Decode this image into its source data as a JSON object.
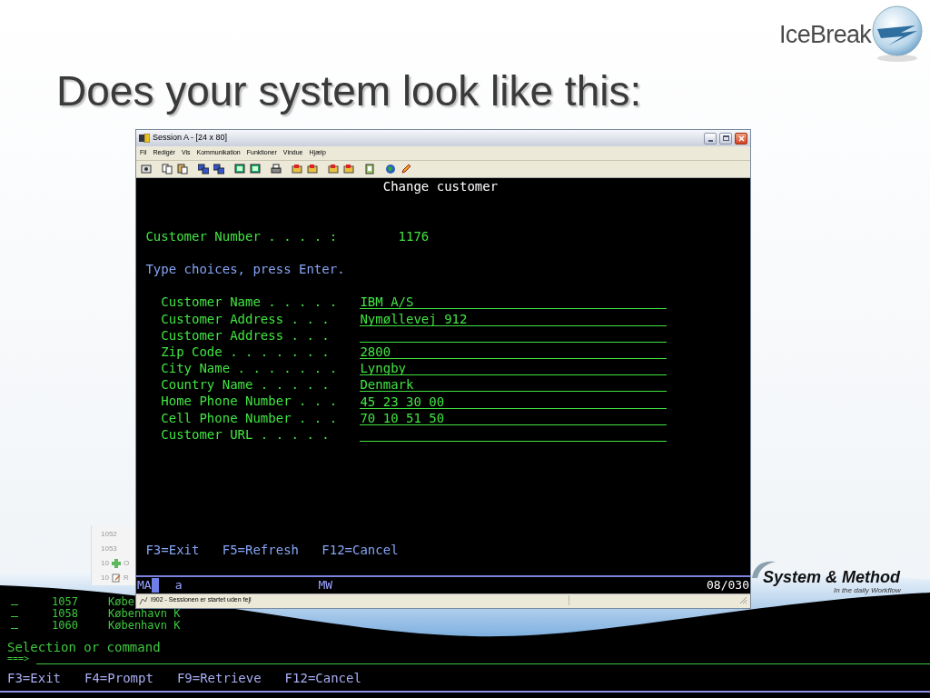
{
  "slide": {
    "title": "Does your system look like this:"
  },
  "logos": {
    "top_name": "IceBreak",
    "bottom_name": "System & Method",
    "bottom_tagline": "In the daily Workflow"
  },
  "background_list": [
    {
      "number": "1052"
    },
    {
      "number": "1053"
    },
    {
      "number": "10",
      "label": "O",
      "kind": "plus"
    },
    {
      "number": "10",
      "label": "R",
      "kind": "note"
    }
  ],
  "window": {
    "title": "Session A - [24 x 80]",
    "menu": [
      "Fil",
      "Redigér",
      "Vis",
      "Kommunikation",
      "Funktioner",
      "Vindue",
      "Hjælp"
    ],
    "screen": {
      "heading": "Change customer",
      "number_label": "Customer Number . . . . :",
      "number_value": "1176",
      "instruction": "Type choices, press Enter.",
      "fields": [
        {
          "label": "Customer Name . . . . .",
          "value": "IBM A/S"
        },
        {
          "label": "Customer Address . . .",
          "value": "Nymøllevej 912"
        },
        {
          "label": "Customer Address . . ."
        },
        {
          "label": "Zip Code . . . . . . .",
          "value": "2800"
        },
        {
          "label": "City Name . . . . . . .",
          "value": "Lyngby"
        },
        {
          "label": "Country Name . . . . .",
          "value": "Denmark"
        },
        {
          "label": "Home Phone Number . . .",
          "value": "45 23 30 00"
        },
        {
          "label": "Cell Phone Number . . .",
          "value": "70 10 51 50"
        },
        {
          "label": "Customer URL . . . . ."
        }
      ],
      "function_keys": [
        "F3=Exit",
        "F5=Refresh",
        "F12=Cancel"
      ]
    },
    "status_line": {
      "indicator": "MA",
      "mode": "a",
      "code": "MW",
      "position": "08/030"
    },
    "status_bar": "I902 - Sessionen er startet uden fejl"
  },
  "background_terminal": {
    "rows": [
      {
        "number": "1057",
        "city": "Købe"
      },
      {
        "number": "1058",
        "city": "København K"
      },
      {
        "number": "1060",
        "city": "København K"
      }
    ],
    "prompt": "Selection or command",
    "command_arrow": "===>",
    "function_keys": [
      "F3=Exit",
      "F4=Prompt",
      "F9=Retrieve",
      "F12=Cancel"
    ]
  }
}
